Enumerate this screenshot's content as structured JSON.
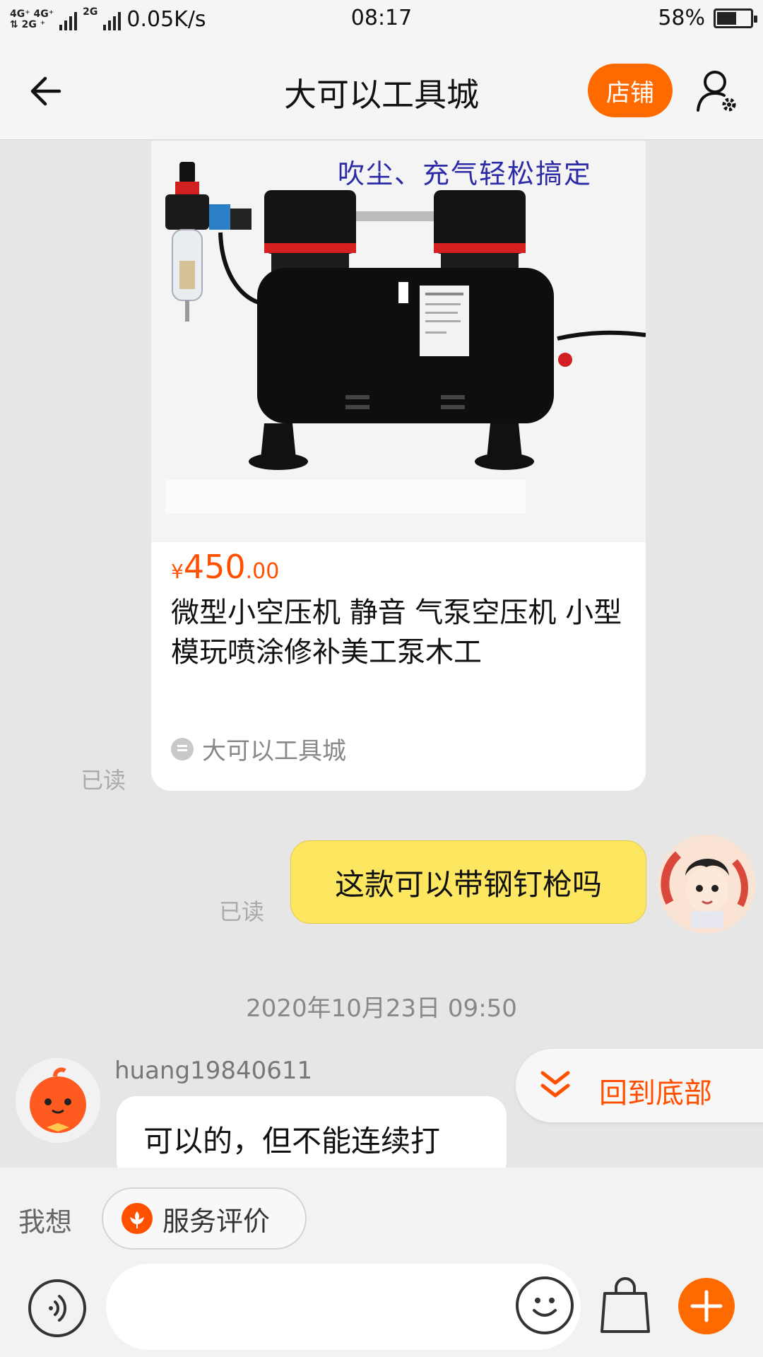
{
  "status_bar": {
    "net_label_1": "4G⁺ 4G⁺",
    "net_label_2": "⇅ 2G ⁺",
    "net_label_3": "2G",
    "speed": "0.05K/s",
    "time": "08:17",
    "battery": "58%",
    "battery_level": 0.58
  },
  "nav": {
    "title": "大可以工具城",
    "shop_button": "店铺",
    "back_icon": "back-arrow-icon",
    "user_icon": "user-settings-icon"
  },
  "product_card": {
    "image_caption": "吹尘、充气轻松搞定",
    "price_currency": "¥",
    "price_int": "450",
    "price_dec": ".00",
    "title": "微型小空压机 静音 气泵空压机 小型 模玩喷涂修补美工泵木工",
    "shop_name": "大可以工具城"
  },
  "messages": {
    "read_label": "已读",
    "my_message": "这款可以带钢钉枪吗",
    "timestamp": "2020年10月23日 09:50",
    "seller_name": "huang19840611",
    "seller_message": "可以的，但不能连续打"
  },
  "back_to_bottom": {
    "label": "回到底部",
    "icon": "double-chevron-down-icon"
  },
  "quick_actions": {
    "label": "我想",
    "chip_label": "服务评价",
    "chip_icon": "flower-icon"
  },
  "input_bar": {
    "placeholder": "",
    "voice_icon": "voice-icon",
    "emoji_icon": "smile-icon",
    "bag_icon": "shopping-bag-icon",
    "plus_icon": "plus-icon"
  },
  "colors": {
    "accent": "#ff6a00",
    "price": "#ff5000",
    "my_bubble": "#fde660",
    "background": "#e6e6e6"
  }
}
